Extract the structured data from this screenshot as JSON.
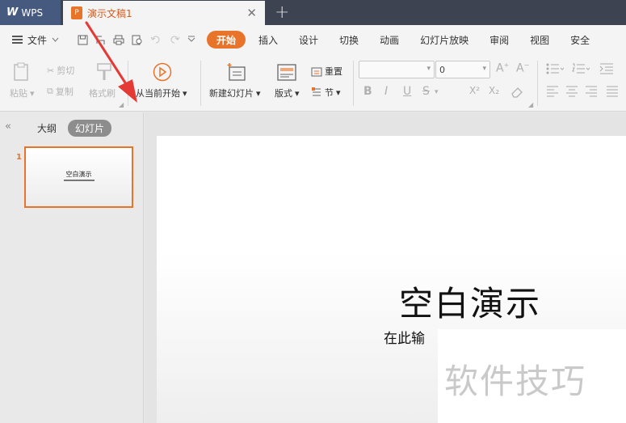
{
  "titlebar": {
    "app_tab_label": "WPS",
    "doc_tab_label": "演示文稿1",
    "doc_tab_icon": "presentation-doc-icon",
    "close_glyph": "✕",
    "new_tab_glyph": "+"
  },
  "menubar": {
    "file_label": "文件",
    "items": [
      {
        "label": "开始",
        "active": true
      },
      {
        "label": "插入"
      },
      {
        "label": "设计"
      },
      {
        "label": "切换"
      },
      {
        "label": "动画"
      },
      {
        "label": "幻灯片放映"
      },
      {
        "label": "审阅"
      },
      {
        "label": "视图"
      },
      {
        "label": "安全"
      }
    ]
  },
  "ribbon": {
    "paste": "粘贴",
    "cut": "剪切",
    "copy": "复制",
    "format_painter": "格式刷",
    "play_from_current": "从当前开始",
    "new_slide": "新建幻灯片",
    "layout": "版式",
    "reset": "重置",
    "section": "节",
    "font_size_value": "0",
    "bold": "B",
    "italic": "I",
    "underline": "U",
    "strike": "S",
    "superscript": "X²",
    "subscript": "X₂"
  },
  "leftpanel": {
    "tab_outline": "大纲",
    "tab_slides": "幻灯片",
    "slide_number": "1",
    "thumb_title": "空白演示"
  },
  "slide": {
    "title": "空白演示",
    "subtitle": "在此输"
  },
  "watermark": {
    "text": "软件技巧"
  },
  "colors": {
    "accent": "#e8742a",
    "titlebar": "#3d4350",
    "arrow": "#e53935"
  }
}
